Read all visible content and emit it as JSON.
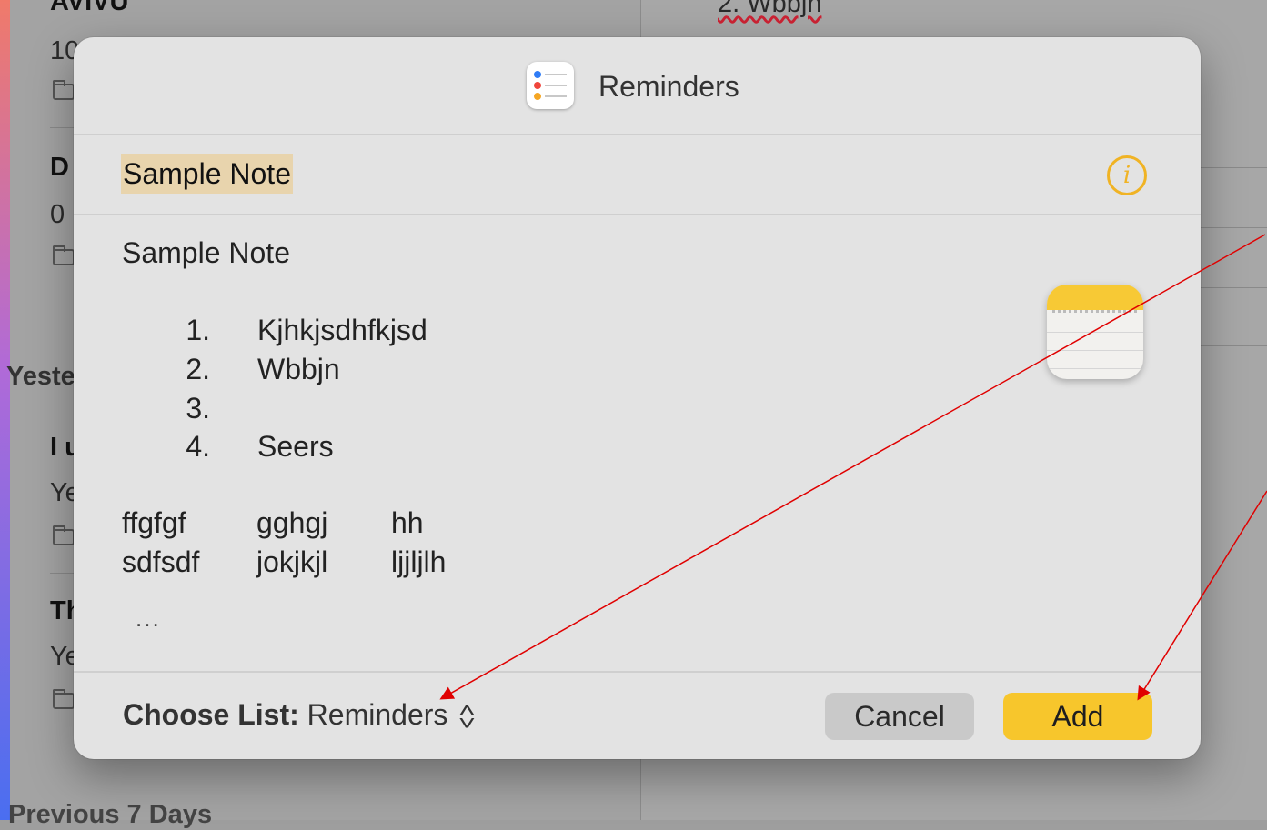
{
  "background": {
    "list_fragments": [
      "AVIVU",
      "10",
      "D",
      "0",
      "Yeste",
      "I u",
      "Ye",
      "Th",
      "Ye",
      "Previous 7 Days"
    ],
    "detail_fragment": "2. Wbbjn"
  },
  "dialog": {
    "app_title": "Reminders",
    "app_icon": "reminders-app-icon",
    "reminder_title": "Sample Note",
    "info_icon_glyph": "i",
    "note": {
      "heading": "Sample Note",
      "list": [
        {
          "num": "1.",
          "text": "Kjhkjsdhfkjsd"
        },
        {
          "num": "2.",
          "text": "Wbbjn"
        },
        {
          "num": "3.",
          "text": ""
        },
        {
          "num": "4.",
          "text": "Seers"
        }
      ],
      "table": [
        [
          "ffgfgf",
          "gghgj",
          "hh"
        ],
        [
          "sdfsdf",
          "jokjkjl",
          "ljjljlh"
        ]
      ],
      "ellipsis": "..."
    },
    "notes_icon": "notes-app-icon",
    "footer": {
      "choose_label": "Choose List:",
      "choose_value": "Reminders",
      "cancel_label": "Cancel",
      "add_label": "Add"
    }
  },
  "colors": {
    "accent": "#f7c62c",
    "info": "#f0b324",
    "annotation_arrow": "#e00000"
  }
}
